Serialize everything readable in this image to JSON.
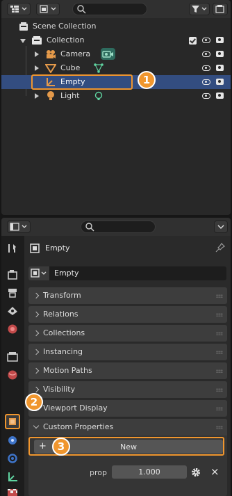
{
  "outliner": {
    "scene_collection": "Scene Collection",
    "collection": "Collection",
    "items": [
      {
        "label": "Camera"
      },
      {
        "label": "Cube"
      },
      {
        "label": "Empty"
      },
      {
        "label": "Light"
      }
    ]
  },
  "properties": {
    "object_name": "Empty",
    "object_field_value": "Empty",
    "panels": [
      {
        "label": "Transform"
      },
      {
        "label": "Relations"
      },
      {
        "label": "Collections"
      },
      {
        "label": "Instancing"
      },
      {
        "label": "Motion Paths"
      },
      {
        "label": "Visibility"
      },
      {
        "label": "Viewport Display"
      },
      {
        "label": "Custom Properties"
      }
    ],
    "new_button": "New",
    "new_plus": "+",
    "prop_label": "prop",
    "prop_value": "1.000",
    "prop_remove": "×"
  },
  "callouts": [
    "1",
    "2",
    "3"
  ],
  "colors": {
    "accent": "#f0962e",
    "selected_row": "#334d80",
    "object_orange": "#e59a4a"
  },
  "icons": {
    "display_mode": "outliner-display-icon",
    "filter": "filter-icon",
    "camera_data": "camera-data-icon",
    "mesh_data": "mesh-data-icon",
    "light_data": "light-data-icon"
  }
}
